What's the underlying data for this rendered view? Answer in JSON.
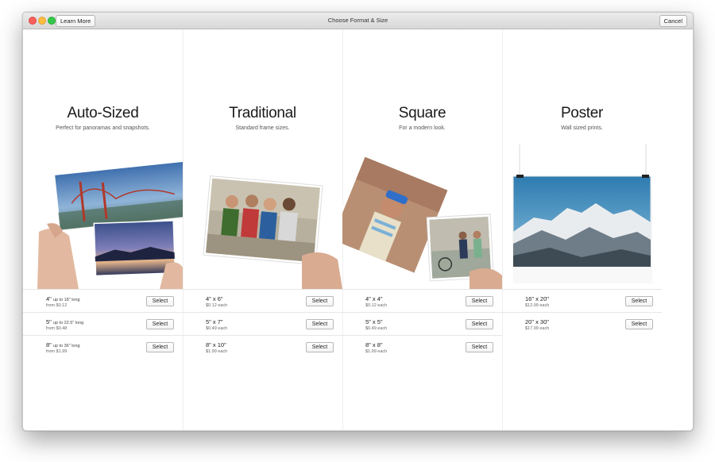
{
  "window": {
    "title": "Choose Format & Size",
    "learn_more_label": "Learn More",
    "cancel_label": "Cancel"
  },
  "columns": [
    {
      "title": "Auto-Sized",
      "subtitle": "Perfect for panoramas and snapshots.",
      "options": [
        {
          "size": "4\"",
          "note": "up to 18\" long",
          "price": "from $0.12",
          "button": "Select"
        },
        {
          "size": "5\"",
          "note": "up to 22.5\" long",
          "price": "from $0.48",
          "button": "Select"
        },
        {
          "size": "8\"",
          "note": "up to 36\" long",
          "price": "from $1.99",
          "button": "Select"
        }
      ]
    },
    {
      "title": "Traditional",
      "subtitle": "Standard frame sizes.",
      "options": [
        {
          "size": "4\" x 6\"",
          "note": "",
          "price": "$0.12 each",
          "button": "Select"
        },
        {
          "size": "5\" x 7\"",
          "note": "",
          "price": "$0.49 each",
          "button": "Select"
        },
        {
          "size": "8\" x 10\"",
          "note": "",
          "price": "$1.99 each",
          "button": "Select"
        }
      ]
    },
    {
      "title": "Square",
      "subtitle": "For a modern look.",
      "options": [
        {
          "size": "4\" x 4\"",
          "note": "",
          "price": "$0.12 each",
          "button": "Select"
        },
        {
          "size": "5\" x 5\"",
          "note": "",
          "price": "$0.49 each",
          "button": "Select"
        },
        {
          "size": "8\" x 8\"",
          "note": "",
          "price": "$1.99 each",
          "button": "Select"
        }
      ]
    },
    {
      "title": "Poster",
      "subtitle": "Wall sized prints.",
      "options": [
        {
          "size": "16\" x 20\"",
          "note": "",
          "price": "$12.99 each",
          "button": "Select"
        },
        {
          "size": "20\" x 30\"",
          "note": "",
          "price": "$17.99 each",
          "button": "Select"
        }
      ]
    }
  ],
  "colors": {
    "traffic_close": "#fc605c",
    "traffic_minimize": "#fdbc40",
    "traffic_maximize": "#34c84a"
  }
}
